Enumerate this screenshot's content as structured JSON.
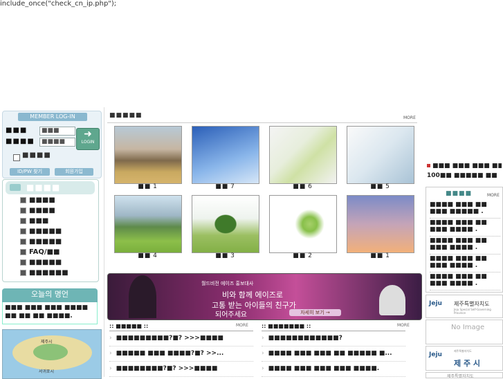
{
  "php_text": "include_once(\"check_cn_ip.php\");",
  "login": {
    "header": "MEMBER LOG-IN",
    "id_label": "■■■",
    "pw_label": "■■■■",
    "id_placeholder": "■■■",
    "pw_placeholder": "■■■■",
    "login_button": "LOGIN",
    "save_label": "■■■■",
    "find_button": "ID/PW 찾기",
    "join_button": "회원가입"
  },
  "menu": {
    "title": "■■■■",
    "items": [
      "■■■■",
      "■■■■",
      "■■■",
      "■■■■■",
      "■■■■■",
      "FAQ/■■",
      "■■■■■",
      "■■■■■■"
    ]
  },
  "today": {
    "title": "오늘의 명언",
    "text": "■■■ ■■■ ■■■ ■■■■ ■■ ■■ ■■ ■■■■."
  },
  "map": {
    "label_city": "제주시",
    "label_south": "서귀포시"
  },
  "gallery": {
    "section_title": "■■■■■",
    "more": "MORE",
    "items": [
      {
        "label": "■■",
        "num": "1"
      },
      {
        "label": "■■",
        "num": "7"
      },
      {
        "label": "■■",
        "num": "6"
      },
      {
        "label": "■■",
        "num": "5"
      },
      {
        "label": "■■",
        "num": "4"
      },
      {
        "label": "■■",
        "num": "3"
      },
      {
        "label": "■■",
        "num": "2"
      },
      {
        "label": "■■",
        "num": "1"
      }
    ]
  },
  "banner": {
    "line1": "월드비전 에이즈 홍보대사",
    "line2": "비와 함께 에이즈로",
    "line3": "고통 받는 아이들의 친구가",
    "line4": "되어주세요",
    "button": "자세히 보기 →"
  },
  "board_left": {
    "title": ":: ■■■■■ ::",
    "more": "MORE",
    "rows": [
      "■■■■■■■■■?■? >>>■■■■",
      "■■■■■ ■■■ ■■■■?■? >>...",
      "■■■■■■■■?■? >>>■■■■"
    ]
  },
  "board_right": {
    "title": ":: ■■■■■■■ ::",
    "more": "MORE",
    "rows": [
      "■■■■■■■■■■■■?",
      "■■■■ ■■■ ■■■ ■■ ■■■■■ ■...",
      "■■■■ ■■■ ■■■ ■■■ ■■■■."
    ]
  },
  "right_top": {
    "line1": "■■■ ■■■ ■■■ ■■",
    "line2": "100■■ ■■■■■ ■■"
  },
  "right_box": {
    "title": "■■■■",
    "more": "MORE",
    "rows": [
      "■■■■ ■■■ ■■ ■■■ ■■■■■ .",
      "■■■■ ■■■ ■■ ■■■ ■■■■ .",
      "■■■■ ■■■ ■■ ■■■ ■■■■ .",
      "■■■■ ■■■ ■■ ■■■ ■■■■ .",
      "■■■■ ■■■ ■■ ■■■ ■■■■ ."
    ]
  },
  "right_banners": {
    "jeju_logo": "Jeju",
    "jeju_province": "제주특별자치도",
    "jeju_province_sub": "Jeju Special Self-Governing Province",
    "no_image": "No Image",
    "jeju_city": "제 주 시",
    "jeju_bottom": "제주특별자치도"
  },
  "colors": {
    "accent": "#6eb5b5",
    "login_btn": "#5fa78e"
  }
}
